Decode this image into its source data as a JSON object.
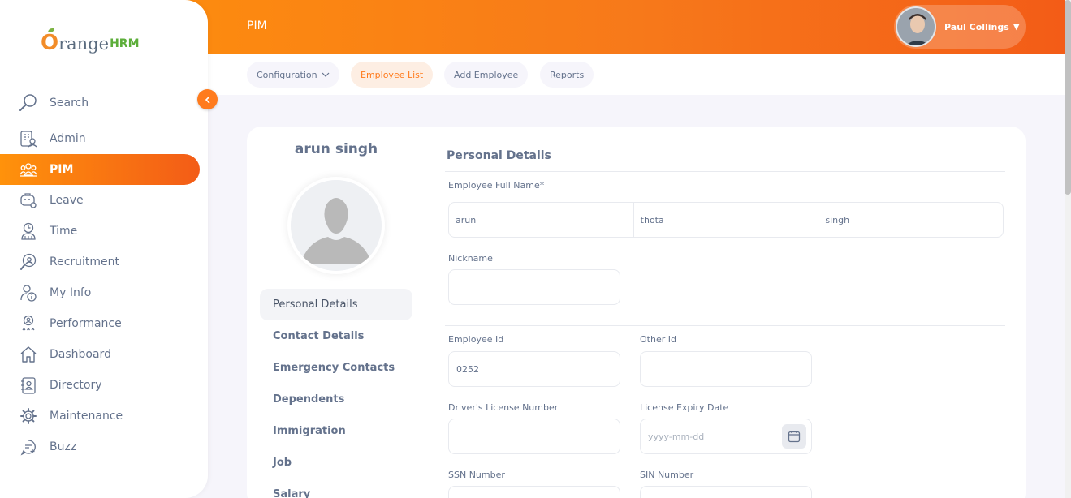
{
  "brand": {
    "logo_o": "O",
    "logo_rest": "range",
    "logo_hrm": "HRM"
  },
  "sidebar": {
    "search_label": "Search",
    "items": [
      {
        "label": "Admin",
        "icon": "admin-icon"
      },
      {
        "label": "PIM",
        "icon": "pim-icon",
        "active": true
      },
      {
        "label": "Leave",
        "icon": "leave-icon"
      },
      {
        "label": "Time",
        "icon": "time-icon"
      },
      {
        "label": "Recruitment",
        "icon": "recruitment-icon"
      },
      {
        "label": "My Info",
        "icon": "my-info-icon"
      },
      {
        "label": "Performance",
        "icon": "performance-icon"
      },
      {
        "label": "Dashboard",
        "icon": "dashboard-icon"
      },
      {
        "label": "Directory",
        "icon": "directory-icon"
      },
      {
        "label": "Maintenance",
        "icon": "maintenance-icon"
      },
      {
        "label": "Buzz",
        "icon": "buzz-icon"
      }
    ]
  },
  "header": {
    "module_title": "PIM",
    "user_name": "Paul Collings"
  },
  "subnav": {
    "configuration": "Configuration",
    "employee_list": "Employee List",
    "add_employee": "Add Employee",
    "reports": "Reports"
  },
  "employee": {
    "display_name": "arun singh"
  },
  "tabs": [
    "Personal Details",
    "Contact Details",
    "Emergency Contacts",
    "Dependents",
    "Immigration",
    "Job",
    "Salary"
  ],
  "form": {
    "section_title": "Personal Details",
    "full_name_label": "Employee Full Name*",
    "first_name": "arun",
    "middle_name": "thota",
    "last_name": "singh",
    "nickname_label": "Nickname",
    "nickname": "",
    "employee_id_label": "Employee Id",
    "employee_id": "0252",
    "other_id_label": "Other Id",
    "other_id": "",
    "license_label": "Driver's License Number",
    "license": "",
    "license_expiry_label": "License Expiry Date",
    "license_expiry_placeholder": "yyyy-mm-dd",
    "ssn_label": "SSN Number",
    "sin_label": "SIN Number"
  },
  "colors": {
    "accent": "#ff7b1d",
    "accent_dark": "#f35c17",
    "text": "#64728c"
  }
}
